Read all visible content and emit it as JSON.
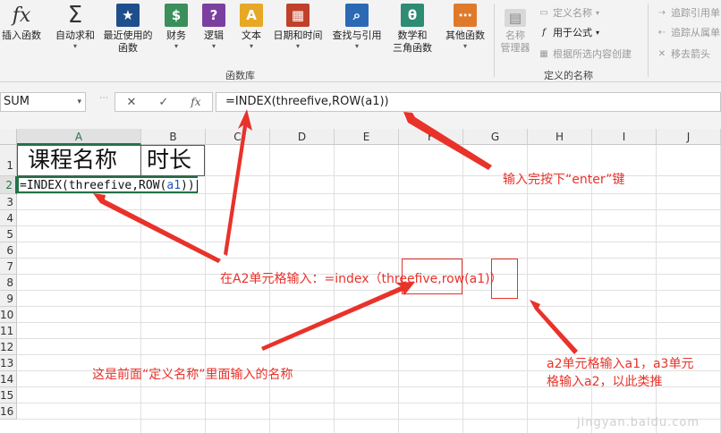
{
  "ribbon": {
    "buttons": [
      {
        "label": "插入函数",
        "icon": "fx-icon",
        "color": "#f3f3f3",
        "glyph": "fx"
      },
      {
        "label": "自动求和",
        "icon": "sigma-icon",
        "color": "#f3f3f3",
        "glyph": "Σ"
      },
      {
        "label": "最近使用的",
        "label2": "函数",
        "icon": "star-book-icon",
        "color": "#1e4e8c",
        "glyph": "★"
      },
      {
        "label": "财务",
        "icon": "finance-icon",
        "color": "#3a8f5a",
        "glyph": "$"
      },
      {
        "label": "逻辑",
        "icon": "logic-icon",
        "color": "#7b3fa0",
        "glyph": "?"
      },
      {
        "label": "文本",
        "icon": "text-icon",
        "color": "#e6a825",
        "glyph": "A"
      },
      {
        "label": "日期和时间",
        "icon": "calendar-icon",
        "color": "#c0402a",
        "glyph": "▦"
      },
      {
        "label": "查找与引用",
        "icon": "lookup-icon",
        "color": "#2c69b5",
        "glyph": "⌕"
      },
      {
        "label": "数学和",
        "label2": "三角函数",
        "icon": "theta-icon",
        "color": "#2e8b74",
        "glyph": "θ"
      },
      {
        "label": "其他函数",
        "icon": "more-functions-icon",
        "color": "#e07a2b",
        "glyph": "⋯"
      }
    ],
    "group_function_library": "函数库",
    "name_manager": {
      "label1": "名称",
      "label2": "管理器"
    },
    "define_name": "定义名称",
    "use_in_formula": "用于公式",
    "create_from_selection": "根据所选内容创建",
    "group_defined_names": "定义的名称",
    "trace_precedents": "追踪引用单",
    "trace_dependents": "追踪从属单",
    "remove_arrows": "移去箭头"
  },
  "formula_bar": {
    "name_box": "SUM",
    "cancel_glyph": "✕",
    "enter_glyph": "✓",
    "fx_glyph": "fx",
    "formula": "=INDEX(threefive,ROW(a1))"
  },
  "grid": {
    "columns": [
      "A",
      "B",
      "C",
      "D",
      "E",
      "F",
      "G",
      "H",
      "I",
      "J"
    ],
    "rows": [
      "1",
      "2",
      "3",
      "4",
      "5",
      "6",
      "7",
      "8",
      "9",
      "10",
      "11",
      "12",
      "13",
      "14",
      "15",
      "16"
    ],
    "a1": "课程名称",
    "b1": "时长",
    "a2_parts": {
      "p1": "=INDEX(threefive,ROW(",
      "p2": "a1",
      "p3": "))"
    }
  },
  "annotations": {
    "enter_hint": "输入完按下“enter”键",
    "a2_hint": "在A2单元格输入：=index（threefive,row(a1)）",
    "name_hint": "这是前面“定义名称”里面输入的名称",
    "row_hint_line1": "a2单元格输入a1，a3单元",
    "row_hint_line2": "格输入a2，以此类推"
  },
  "watermark": "jingyan.baidu.com",
  "colors": {
    "accent": "#217346",
    "annotation": "#e8322a"
  }
}
